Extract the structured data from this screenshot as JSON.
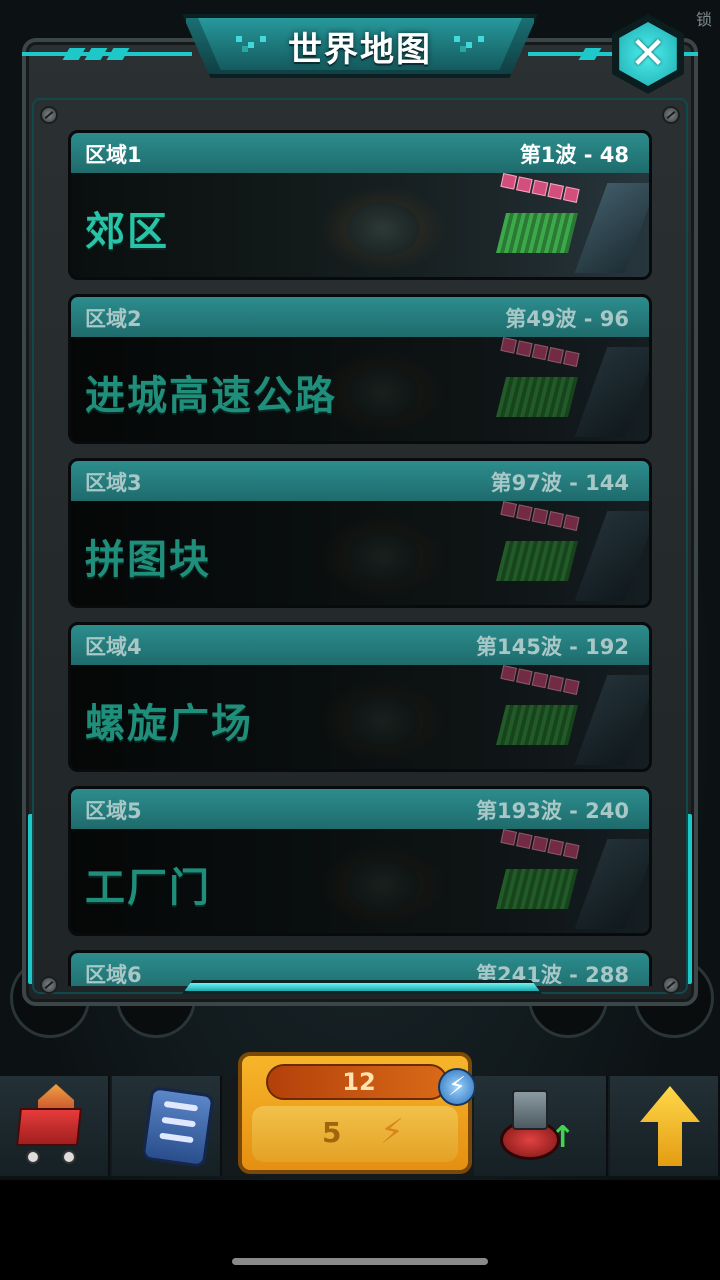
{
  "header": {
    "title": "世界地图",
    "corner_text": "锁"
  },
  "regions": [
    {
      "region": "区域1",
      "waves": "第1波 - 48",
      "name": "郊区",
      "locked": false
    },
    {
      "region": "区域2",
      "waves": "第49波 - 96",
      "name": "进城高速公路",
      "locked": true
    },
    {
      "region": "区域3",
      "waves": "第97波 - 144",
      "name": "拼图块",
      "locked": true
    },
    {
      "region": "区域4",
      "waves": "第145波 - 192",
      "name": "螺旋广场",
      "locked": true
    },
    {
      "region": "区域5",
      "waves": "第193波 - 240",
      "name": "工厂门",
      "locked": true
    },
    {
      "region": "区域6",
      "waves": "第241波 - 288",
      "name": "",
      "locked": true
    }
  ],
  "toolbar": {
    "energy_top_value": "12",
    "energy_bottom_value": "5"
  },
  "colors": {
    "accent_cyan": "#1ec8c8",
    "region_name_green": "#27c4a8",
    "energy_orange": "#f7b52a"
  },
  "icons": [
    "close-icon",
    "shop-cart-icon",
    "document-icon",
    "energy-bolt-icon",
    "turret-upgrade-icon",
    "upgrade-arrow-icon"
  ]
}
